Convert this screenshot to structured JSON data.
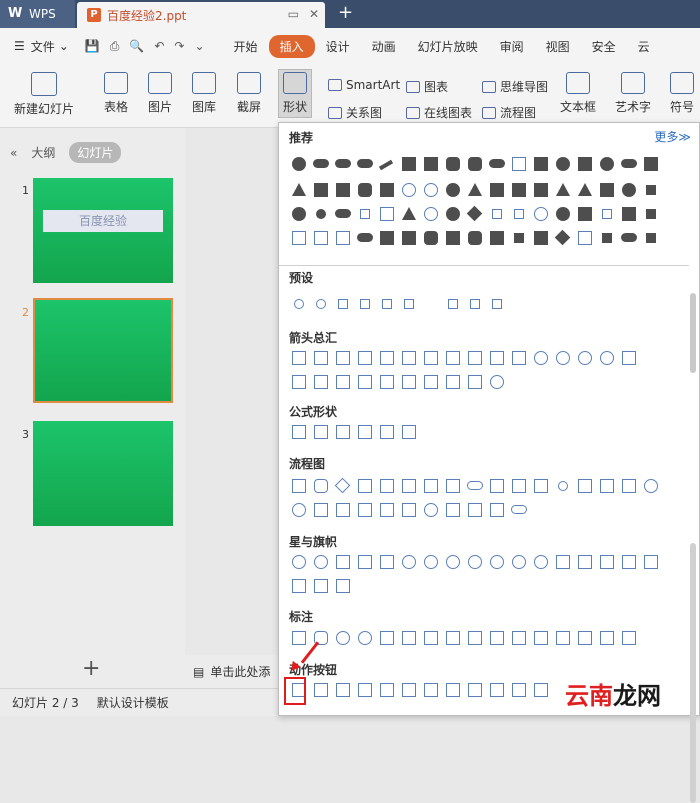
{
  "titlebar": {
    "app": "WPS",
    "doc_tab": "百度经验2.ppt",
    "plus": "+"
  },
  "menubar": {
    "file": "文件",
    "tabs": [
      "开始",
      "插入",
      "设计",
      "动画",
      "幻灯片放映",
      "审阅",
      "视图",
      "安全",
      "云"
    ],
    "active_tab": "插入"
  },
  "ribbon": {
    "new_slide": "新建幻灯片",
    "table": "表格",
    "image": "图片",
    "gallery": "图库",
    "screenshot": "截屏",
    "shapes": "形状",
    "smartart": "SmartArt",
    "chart": "图表",
    "mindmap": "思维导图",
    "relation": "关系图",
    "online_chart": "在线图表",
    "flowchart": "流程图",
    "textbox": "文本框",
    "wordart": "艺术字",
    "symbol": "符号"
  },
  "sidebar": {
    "tab_outline": "大纲",
    "tab_slides": "幻灯片",
    "slides": [
      {
        "num": "1",
        "label": "百度经验"
      },
      {
        "num": "2",
        "label": ""
      },
      {
        "num": "3",
        "label": ""
      }
    ],
    "add": "+"
  },
  "notes": {
    "hint": "单击此处添"
  },
  "status": {
    "slide": "幻灯片 2 / 3",
    "template": "默认设计模板"
  },
  "panel": {
    "recommended": "推荐",
    "more": "更多≫",
    "sections": [
      "预设",
      "箭头总汇",
      "公式形状",
      "流程图",
      "星与旗帜",
      "标注",
      "动作按钮"
    ]
  },
  "watermark": {
    "part1": "云南",
    "part2": "龙网"
  }
}
